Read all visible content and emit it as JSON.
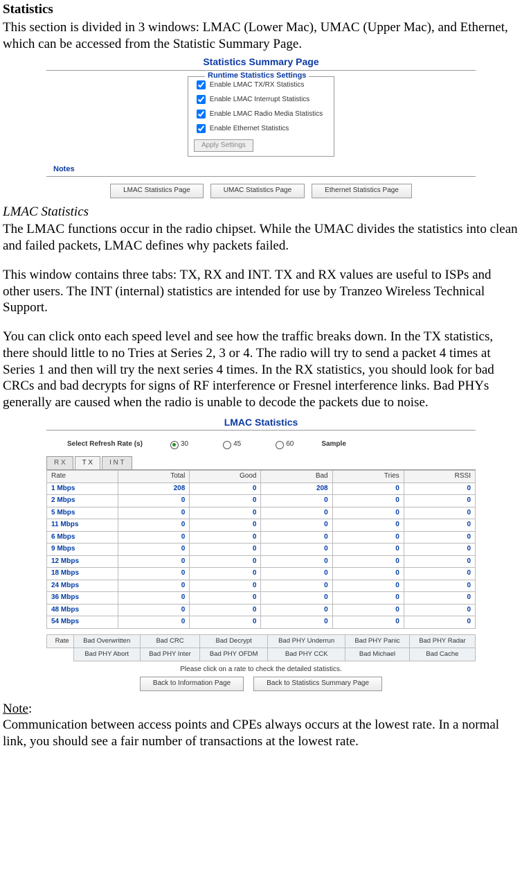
{
  "doc": {
    "heading": "Statistics",
    "intro": "This section is divided in 3 windows: LMAC (Lower Mac), UMAC (Upper Mac), and Ethernet, which can be accessed from the Statistic Summary Page.",
    "sub1": "LMAC Statistics",
    "p1": "The LMAC functions occur in the radio chipset. While the UMAC divides the statistics into clean and failed packets, LMAC defines why packets failed.",
    "p2": "This window contains three tabs: TX, RX and INT. TX and RX values are useful to ISPs and other users. The INT (internal) statistics are intended for use by Tranzeo Wireless Technical Support.",
    "p3": "You can click onto each speed level and see how the traffic breaks down. In the TX statistics, there should little to no Tries at Series 2, 3 or 4. The radio will try to send a packet 4 times at Series 1 and then will try the next series 4 times. In the RX statistics, you should look for bad CRCs and bad decrypts for signs of RF interference or Fresnel interference links. Bad PHYs generally are caused when the radio is unable to decode the packets due to noise.",
    "note_label": "Note",
    "note_colon": ":",
    "note_body": "Communication between access points and CPEs always occurs at the lowest rate. In a normal link, you should see a fair number of transactions at the lowest rate."
  },
  "summary_ui": {
    "title": "Statistics Summary Page",
    "settings_title": "Runtime Statistics Settings",
    "cb1": "Enable LMAC TX/RX Statistics",
    "cb2": "Enable LMAC Interrupt Statistics",
    "cb3": "Enable LMAC Radio Media Statistics",
    "cb4": "Enable Ethernet Statistics",
    "apply": "Apply Settings",
    "notes": "Notes",
    "btn1": "LMAC Statistics Page",
    "btn2": "UMAC Statistics Page",
    "btn3": "Ethernet Statistics Page"
  },
  "lmac_ui": {
    "title": "LMAC Statistics",
    "refresh_label": "Select Refresh Rate (s)",
    "r30": "30",
    "r45": "45",
    "r60": "60",
    "sample": "Sample",
    "tabs": {
      "rx": "R X",
      "tx": "T X",
      "int": "I N T"
    },
    "cols": {
      "rate": "Rate",
      "total": "Total",
      "good": "Good",
      "bad": "Bad",
      "tries": "Tries",
      "rssi": "RSSI"
    },
    "rows": [
      {
        "rate": "1 Mbps",
        "total": "208",
        "good": "0",
        "bad": "208",
        "tries": "0",
        "rssi": "0"
      },
      {
        "rate": "2 Mbps",
        "total": "0",
        "good": "0",
        "bad": "0",
        "tries": "0",
        "rssi": "0"
      },
      {
        "rate": "5 Mbps",
        "total": "0",
        "good": "0",
        "bad": "0",
        "tries": "0",
        "rssi": "0"
      },
      {
        "rate": "11 Mbps",
        "total": "0",
        "good": "0",
        "bad": "0",
        "tries": "0",
        "rssi": "0"
      },
      {
        "rate": "6 Mbps",
        "total": "0",
        "good": "0",
        "bad": "0",
        "tries": "0",
        "rssi": "0"
      },
      {
        "rate": "9 Mbps",
        "total": "0",
        "good": "0",
        "bad": "0",
        "tries": "0",
        "rssi": "0"
      },
      {
        "rate": "12 Mbps",
        "total": "0",
        "good": "0",
        "bad": "0",
        "tries": "0",
        "rssi": "0"
      },
      {
        "rate": "18 Mbps",
        "total": "0",
        "good": "0",
        "bad": "0",
        "tries": "0",
        "rssi": "0"
      },
      {
        "rate": "24 Mbps",
        "total": "0",
        "good": "0",
        "bad": "0",
        "tries": "0",
        "rssi": "0"
      },
      {
        "rate": "36 Mbps",
        "total": "0",
        "good": "0",
        "bad": "0",
        "tries": "0",
        "rssi": "0"
      },
      {
        "rate": "48 Mbps",
        "total": "0",
        "good": "0",
        "bad": "0",
        "tries": "0",
        "rssi": "0"
      },
      {
        "rate": "54 Mbps",
        "total": "0",
        "good": "0",
        "bad": "0",
        "tries": "0",
        "rssi": "0"
      }
    ],
    "sec": {
      "rate": "Rate",
      "c1": "Bad Overwritten",
      "c2": "Bad CRC",
      "c3": "Bad Decrypt",
      "c4": "Bad PHY Underrun",
      "c5": "Bad PHY Panic",
      "c6": "Bad PHY Radar",
      "c7": "Bad PHY Abort",
      "c8": "Bad PHY Inter",
      "c9": "Bad PHY OFDM",
      "c10": "Bad PHY CCK",
      "c11": "Bad Michael",
      "c12": "Bad Cache"
    },
    "click_note": "Please click on a rate to check the detailed statistics.",
    "btn_back1": "Back to Information Page",
    "btn_back2": "Back to Statistics Summary Page"
  }
}
